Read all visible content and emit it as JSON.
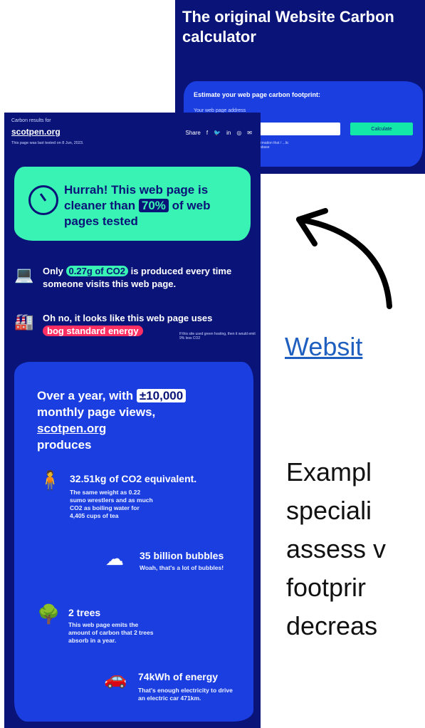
{
  "calculator": {
    "title": "The original Website Carbon calculator",
    "heading": "Estimate your web page carbon footprint:",
    "input_label": "Your web page address",
    "button": "Calculate",
    "note": "information that / ...lic database"
  },
  "results": {
    "header_small": "Carbon results for",
    "site": "scotpen.org",
    "tested": "This page was last tested on 8 Jun, 2023.",
    "share_label": "Share",
    "share_icons": [
      "facebook-icon",
      "twitter-icon",
      "linkedin-icon",
      "whatsapp-icon",
      "email-icon"
    ],
    "hurrah": {
      "pre": "Hurrah! This web page is cleaner than ",
      "percent": "70%",
      "post": " of web pages tested"
    },
    "co2_row": {
      "pre": "Only ",
      "amount": "0.27g of CO2",
      "post": " is produced every time someone visits this web page."
    },
    "energy_row": {
      "text": "Oh no, it looks like this web page uses",
      "tag": "bog standard energy",
      "note": "If this site used green hosting, then it would emit 9% less CO2"
    },
    "year": {
      "pre": "Over a year, with ",
      "views": "±10,000",
      "mid": "monthly page views,",
      "site": "scotpen.org",
      "post": "produces"
    },
    "facts": [
      {
        "title": "32.51kg of CO2 equivalent.",
        "body": "The same weight as 0.22 sumo wrestlers and as much CO2 as boiling water for 4,405 cups of tea"
      },
      {
        "title": "35 billion bubbles",
        "body": "Woah, that's a lot of bubbles!"
      },
      {
        "title": "2 trees",
        "body": "This web page emits the amount of carbon that 2 trees absorb in a year."
      },
      {
        "title": "74kWh of energy",
        "body": "That's enough electricity to drive an electric car 471km."
      }
    ]
  },
  "side": {
    "link": "Websit",
    "paragraph_lines": [
      "Exampl",
      "speciali",
      "assess v",
      "footprir",
      "decreas"
    ]
  }
}
